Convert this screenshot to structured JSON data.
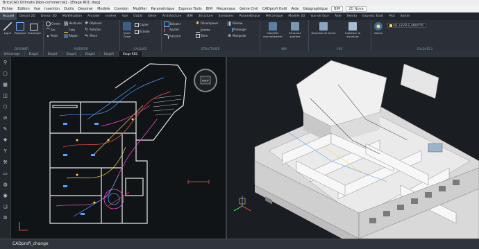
{
  "app": {
    "title": "BricsCAD Ultimate [Non-commercial] - [Etage RDC.dwg]"
  },
  "menubar": {
    "items": [
      "Fichier",
      "Edition",
      "Vue",
      "Insertion",
      "Outils",
      "Dessiner",
      "Modèle",
      "Coordon",
      "Modifier",
      "Paramétrique",
      "Express Tools",
      "BIM",
      "Mécanique",
      "Génie Civil",
      "CADprofi Outil",
      "Aide",
      "Géographique"
    ],
    "workspace": "BIM",
    "layer": "2D Nova"
  },
  "ribbon_tabs": [
    "Accueil",
    "Dessin 2D",
    "Dessin 3D",
    "Modélisation",
    "Annoter",
    "Insérer",
    "Vue",
    "Outils",
    "Gérer",
    "Architecture",
    "BIM",
    "Structure",
    "Symboles",
    "Paramétrique",
    "Mécanique",
    "Modèle 3D",
    "Vue de face",
    "Aide",
    "Rendu",
    "Express Tools",
    "Plot",
    "Sortie"
  ],
  "ribbon": {
    "groups": [
      "DESSINER",
      "MODIFIER",
      "CALQUES",
      "STRUCTURER",
      "BIM",
      "VUE",
      "CALQUES 2"
    ],
    "buttons": {
      "line": "Ligne",
      "polyline": "Polyligne",
      "rectangle": "Rectangle",
      "circle": "Cercle",
      "quickdraw": "Quick Draw",
      "hatch": "Hachures",
      "arc": "Arc",
      "dimension": "Cote",
      "point": "Point",
      "region": "Région",
      "move": "Déplacer",
      "copy": "Copier",
      "rotate": "Rotation",
      "stretch": "Étirer",
      "scale": "Échelle",
      "manipulate": "Manipuler",
      "mirror": "Miroir",
      "offset": "Décaler",
      "trim": "Ajuster",
      "fillet": "Raccord",
      "explode": "Décomposer",
      "join": "Joindre",
      "array": "Réseau",
      "extend": "Prolonger",
      "classify": "Classifier manuellement",
      "structure": "Structure spatiale",
      "bimprops": "Données de forme",
      "explore": "Initialiser la structure",
      "gizmo": "Gizmo",
      "layers": "ALL_LEVELS_ANALYTIC"
    }
  },
  "doc_tabs": [
    "Démarrage",
    "Etage1",
    "Etage2",
    "Etage3",
    "Etage4",
    "Etage5",
    "Etage RDC"
  ],
  "doc_active": 6,
  "view2d": {
    "viewcube_label": "HAUT"
  },
  "cmdline": {
    "text": "CADprofi_change"
  },
  "colors": {
    "accent": "#4da3ff",
    "wall": "#f2f2f2",
    "pipe_blue": "#5aa0ff",
    "pipe_red": "#ff5252",
    "pipe_yellow": "#ffd84d",
    "pipe_magenta": "#ff4fd0"
  }
}
